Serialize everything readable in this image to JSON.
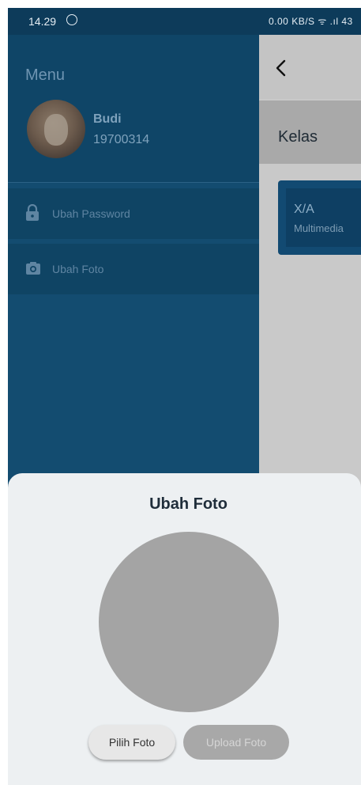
{
  "status_bar": {
    "time": "14.29",
    "right_indicators": "0.00 KB/S  ᯤ .ıl 43"
  },
  "page": {
    "header_title": "Kelas",
    "class_card": {
      "name": "X/A",
      "subtitle": "Multimedia"
    }
  },
  "drawer": {
    "title": "Menu",
    "user": {
      "name": "Budi",
      "id": "19700314"
    },
    "items": [
      {
        "label": "Ubah Password",
        "icon": "lock-icon"
      },
      {
        "label": "Ubah Foto",
        "icon": "camera-icon"
      }
    ]
  },
  "sheet": {
    "title": "Ubah Foto",
    "pick_button": "Pilih Foto",
    "upload_button": "Upload Foto"
  },
  "colors": {
    "drawer": "#134c70",
    "statusbar": "#0d3b5a",
    "sheet": "#edf0f2",
    "photo_placeholder": "#a4a4a4"
  }
}
